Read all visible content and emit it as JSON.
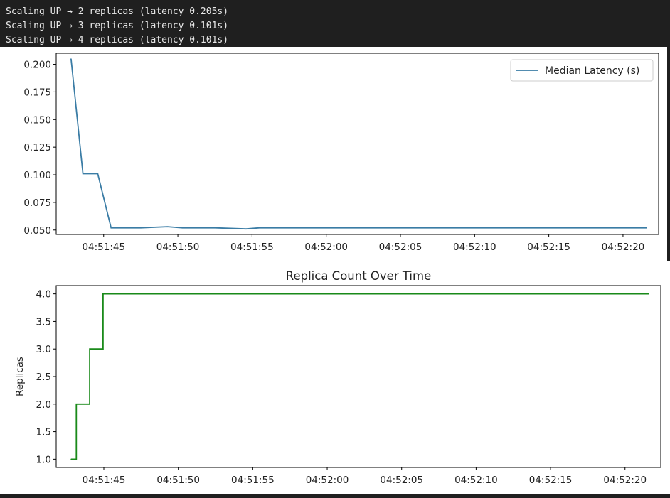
{
  "console": {
    "lines": [
      "Scaling UP → 2 replicas (latency 0.205s)",
      "Scaling UP → 3 replicas (latency 0.101s)",
      "Scaling UP → 4 replicas (latency 0.101s)"
    ]
  },
  "colors": {
    "latency_line": "#3a7ca5",
    "replica_line": "#1a8a1a"
  },
  "chart_data": [
    {
      "type": "line",
      "title": "",
      "xlabel": "",
      "ylabel": "",
      "x_tick_labels": [
        "04:51:45",
        "04:51:50",
        "04:51:55",
        "04:52:00",
        "04:52:05",
        "04:52:10",
        "04:52:15",
        "04:52:20"
      ],
      "x_tick_seconds": [
        45,
        50,
        55,
        60,
        65,
        70,
        75,
        80
      ],
      "xlim": [
        41.8,
        82.4
      ],
      "ylim": [
        0.046,
        0.21
      ],
      "y_ticks": [
        "0.200",
        "0.175",
        "0.150",
        "0.125",
        "0.100",
        "0.075",
        "0.050"
      ],
      "y_tick_values": [
        0.2,
        0.175,
        0.15,
        0.125,
        0.1,
        0.075,
        0.05
      ],
      "legend_position": "top-right",
      "series": [
        {
          "name": "Median Latency (s)",
          "x": [
            42.8,
            43.6,
            44.6,
            45.5,
            47.5,
            49.3,
            50.3,
            52.5,
            54.6,
            55.5,
            57.5,
            60.5,
            63.5,
            66.5,
            69.5,
            72.5,
            75.5,
            78.5,
            81.6
          ],
          "y": [
            0.205,
            0.101,
            0.101,
            0.052,
            0.052,
            0.053,
            0.052,
            0.052,
            0.051,
            0.052,
            0.052,
            0.052,
            0.052,
            0.052,
            0.052,
            0.052,
            0.052,
            0.052,
            0.052
          ]
        }
      ]
    },
    {
      "type": "line",
      "title": "Replica Count Over Time",
      "xlabel": "",
      "ylabel": "Replicas",
      "x_tick_labels": [
        "04:51:45",
        "04:51:50",
        "04:51:55",
        "04:52:00",
        "04:52:05",
        "04:52:10",
        "04:52:15",
        "04:52:20"
      ],
      "x_tick_seconds": [
        45,
        50,
        55,
        60,
        65,
        70,
        75,
        80
      ],
      "xlim": [
        41.8,
        82.4
      ],
      "ylim": [
        0.85,
        4.15
      ],
      "y_ticks": [
        "4.0",
        "3.5",
        "3.0",
        "2.5",
        "2.0",
        "1.5",
        "1.0"
      ],
      "y_tick_values": [
        4.0,
        3.5,
        3.0,
        2.5,
        2.0,
        1.5,
        1.0
      ],
      "series": [
        {
          "name": "",
          "step": true,
          "x": [
            42.8,
            43.15,
            44.05,
            44.95,
            81.6
          ],
          "y": [
            1,
            2,
            3,
            4,
            4
          ]
        }
      ]
    }
  ]
}
